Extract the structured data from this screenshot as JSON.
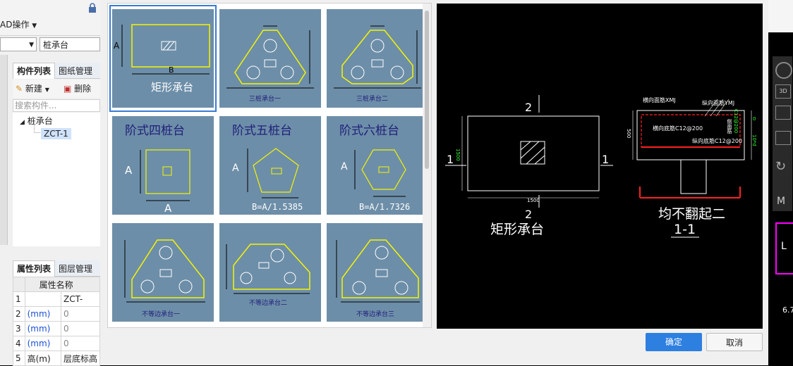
{
  "app": {
    "cad_menu": "AD操作",
    "floor_combo": "",
    "type_combo": "桩承台",
    "component_tabs": [
      "构件列表",
      "图纸管理"
    ],
    "toolbar": {
      "new_label": "新建",
      "delete_label": "删除"
    },
    "search_placeholder": "搜索构件...",
    "tree": {
      "root": "桩承台",
      "child": "ZCT-1"
    },
    "property_tabs": [
      "属性列表",
      "图层管理"
    ],
    "property_table": {
      "header": "属性名称",
      "rows": [
        {
          "num": "1",
          "name": "",
          "value": "ZCT-"
        },
        {
          "num": "2",
          "name": "(mm)",
          "value": "0"
        },
        {
          "num": "3",
          "name": "(mm)",
          "value": "0"
        },
        {
          "num": "4",
          "name": "(mm)",
          "value": "0"
        },
        {
          "num": "5",
          "name": "高(m)",
          "value": "层底标高"
        }
      ]
    }
  },
  "dialog": {
    "thumbnails": [
      {
        "name": "矩形承台",
        "caption": "矩形承台",
        "labels": [
          "A",
          "B"
        ],
        "selected": true
      },
      {
        "name": "三桩承台一",
        "caption": "三桩承台一"
      },
      {
        "name": "三桩承台二",
        "caption": "三桩承台二"
      },
      {
        "name": "阶式四桩台",
        "caption": "阶式四桩台",
        "labels": [
          "A",
          "A"
        ]
      },
      {
        "name": "阶式五桩台",
        "caption": "阶式五桩台",
        "labels": [
          "A",
          "B=A/1.5385"
        ]
      },
      {
        "name": "阶式六桩台",
        "caption": "阶式六桩台",
        "labels": [
          "A",
          "B=A/1.7326"
        ]
      },
      {
        "name": "不等边承台一",
        "caption": "不等边承台一"
      },
      {
        "name": "不等边承台二",
        "caption": "不等边承台二"
      },
      {
        "name": "不等边承台三",
        "caption": "不等边承台三"
      }
    ],
    "preview": {
      "section_marks": [
        "2",
        "1",
        "1",
        "2"
      ],
      "dims": [
        "1500",
        "1500",
        "500"
      ],
      "rebar_labels": [
        "横向面筋XMJ",
        "纵向面筋YMJ",
        "横向底筋C12@200",
        "纵向底筋C12@200"
      ],
      "right_dims": [
        "0",
        "侧面筋",
        "C12@200",
        "10*d"
      ],
      "title": "矩形承台",
      "section_title": "均不翻起二",
      "section_name": "1-1"
    },
    "ok_label": "确定",
    "cancel_label": "取消"
  },
  "right_strip": {
    "labels": [
      "3D",
      "M",
      "L",
      "6.7"
    ]
  },
  "colors": {
    "thumb_bg": "#6d8ea8",
    "outline_yellow": "#f5f500",
    "select_blue": "#3a7bd5",
    "primary": "#2d7fe0",
    "rebar_red": "#ff2020",
    "dim_green": "#33ff33"
  }
}
